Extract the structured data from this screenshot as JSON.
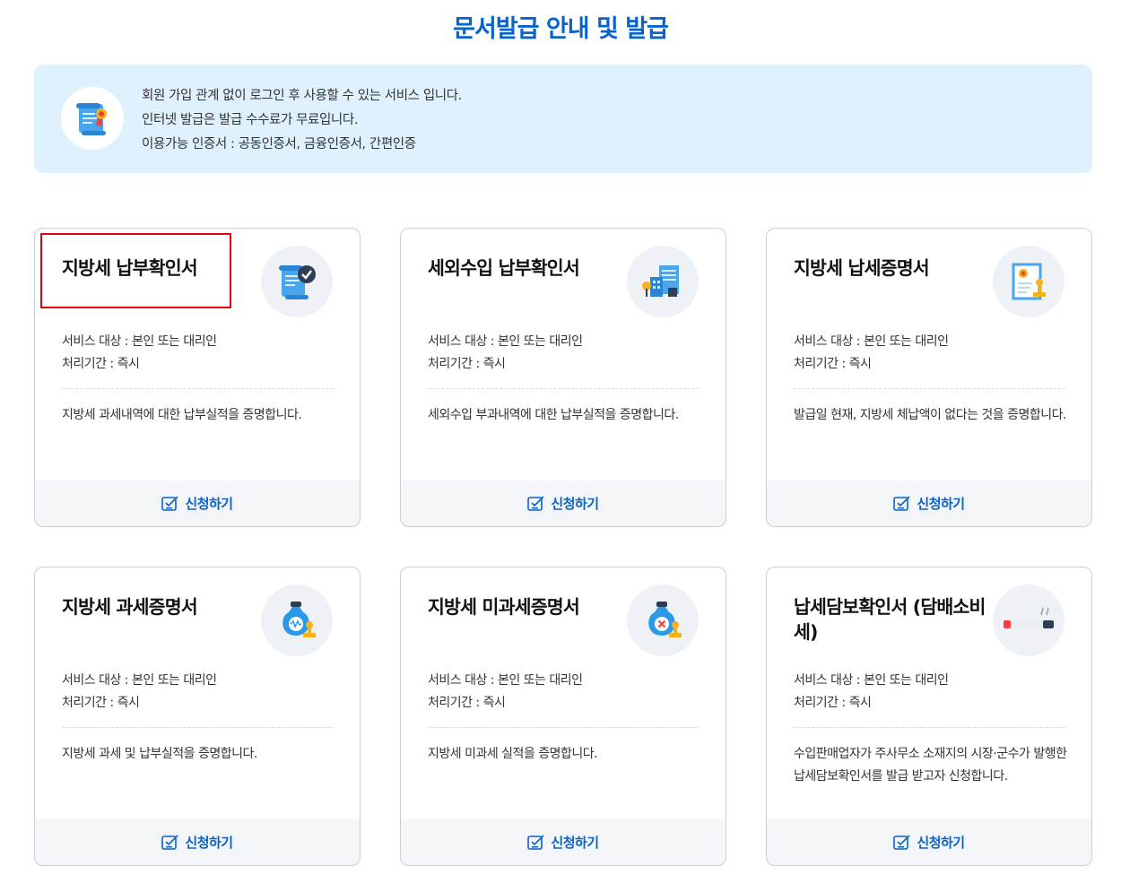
{
  "page": {
    "title": "문서발급 안내 및 발급"
  },
  "info": {
    "icon": "certificate-scroll-icon",
    "lines": [
      "회원 가입 관계 없이 로그인 후 사용할 수 있는 서비스 입니다.",
      "인터넷 발급은 발급 수수료가 무료입니다.",
      "이용가능 인증서 : 공동인증서, 금융인증서, 간편인증"
    ]
  },
  "cards": [
    {
      "title": "지방세 납부확인서",
      "icon": "scroll-check-icon",
      "target": "서비스 대상 : 본인 또는 대리인",
      "period": "처리기간 : 즉시",
      "desc": "지방세 과세내역에 대한 납부실적을 증명합니다.",
      "apply": "신청하기"
    },
    {
      "title": "세외수입 납부확인서",
      "icon": "building-document-icon",
      "target": "서비스 대상 : 본인 또는 대리인",
      "period": "처리기간 : 즉시",
      "desc": "세외수입 부과내역에 대한 납부실적을 증명합니다.",
      "apply": "신청하기"
    },
    {
      "title": "지방세 납세증명서",
      "icon": "certificate-stamp-icon",
      "target": "서비스 대상 : 본인 또는 대리인",
      "period": "처리기간 : 즉시",
      "desc": "발급일 현재, 지방세 체납액이 없다는 것을 증명합니다.",
      "apply": "신청하기"
    },
    {
      "title": "지방세 과세증명서",
      "icon": "money-bag-stamp-icon",
      "target": "서비스 대상 : 본인 또는 대리인",
      "period": "처리기간 : 즉시",
      "desc": "지방세 과세 및 납부실적을 증명합니다.",
      "apply": "신청하기"
    },
    {
      "title": "지방세 미과세증명서",
      "icon": "money-bag-cancel-icon",
      "target": "서비스 대상 : 본인 또는 대리인",
      "period": "처리기간 : 즉시",
      "desc": "지방세 미과세 실적을 증명합니다.",
      "apply": "신청하기"
    },
    {
      "title": "납세담보확인서 (담배소비세)",
      "icon": "cigarette-icon",
      "target": "서비스 대상 : 본인 또는 대리인",
      "period": "처리기간 : 즉시",
      "desc": "수입판매업자가 주사무소 소재지의 시장·군수가 발행한 납세담보확인서를 발급 받고자 신청합니다.",
      "apply": "신청하기"
    }
  ],
  "colors": {
    "accent": "#0a63c9",
    "info_bg": "#dff1fd",
    "highlight": "#e60012"
  }
}
